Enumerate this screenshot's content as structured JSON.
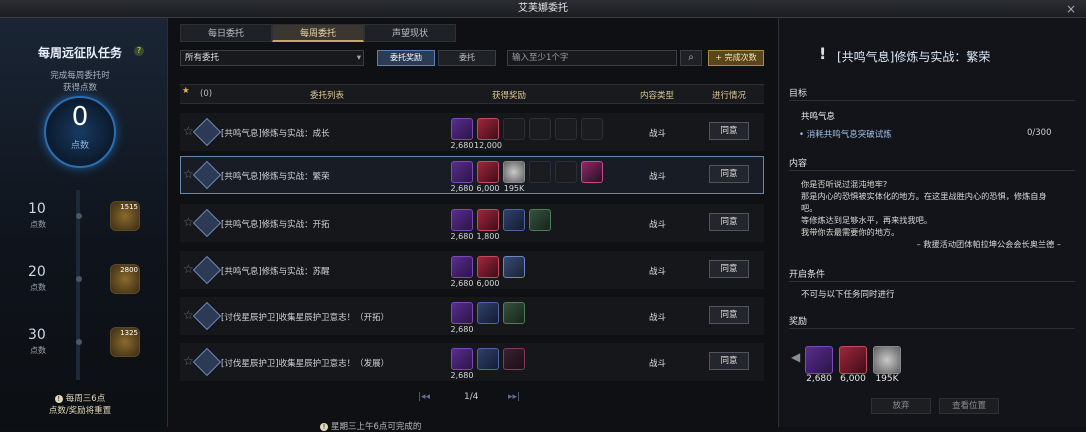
{
  "window": {
    "title": "艾芙娜委托",
    "close": "×"
  },
  "left": {
    "title": "每周远征队任务",
    "help": "?",
    "sub1": "完成每周委托时",
    "sub2": "获得点数",
    "points": "0",
    "points_unit": "点数",
    "steps": [
      {
        "value": "10",
        "unit": "点数",
        "coin": "1515"
      },
      {
        "value": "20",
        "unit": "点数",
        "coin": "2800"
      },
      {
        "value": "30",
        "unit": "点数",
        "coin": "1325"
      }
    ],
    "footer1": "每周三6点",
    "footer2": "点数/奖励将重置"
  },
  "main": {
    "tabs": [
      {
        "label": "每日委托"
      },
      {
        "label": "每周委托"
      },
      {
        "label": "声望现状"
      }
    ],
    "filter": "所有委托",
    "toggle_reward": "委托奖励",
    "toggle_commission": "委托",
    "search_placeholder": "输入至少1个字",
    "add_button": "+ 完成次数",
    "header": {
      "star_count": "(0)",
      "list": "委托列表",
      "reward": "获得奖励",
      "type": "内容类型",
      "progress": "进行情况"
    },
    "rows": [
      {
        "name": "[共鸣气息]修炼与实战：成长",
        "n1": "2,680",
        "n2": "12,000",
        "n3": "",
        "type": "战斗",
        "btn": "同意"
      },
      {
        "name": "[共鸣气息]修炼与实战：繁荣",
        "n1": "2,680",
        "n2": "6,000",
        "n3": "195K",
        "type": "战斗",
        "btn": "同意"
      },
      {
        "name": "[共鸣气息]修炼与实战：开拓",
        "n1": "2,680",
        "n2": "1,800",
        "n3": "",
        "type": "战斗",
        "btn": "同意"
      },
      {
        "name": "[共鸣气息]修炼与实战：苏醒",
        "n1": "2,680",
        "n2": "6,000",
        "n3": "",
        "type": "战斗",
        "btn": "同意"
      },
      {
        "name": "[讨伐星辰护卫]收集星辰护卫意志！（开拓）",
        "n1": "2,680",
        "n2": "",
        "n3": "",
        "type": "战斗",
        "btn": "同意"
      },
      {
        "name": "[讨伐星辰护卫]收集星辰护卫意志！（发展）",
        "n1": "2,680",
        "n2": "",
        "n3": "",
        "type": "战斗",
        "btn": "同意"
      }
    ],
    "page": "1/4",
    "notice": "星期三上午6点可完成的"
  },
  "right": {
    "title": "[共鸣气息]修炼与实战：繁荣",
    "target_label": "目标",
    "objective": "共鸣气息",
    "goal": "• 消耗共鸣气息突破试炼",
    "goal_value": "0/300",
    "content_label": "内容",
    "desc": [
      "你是否听说过混沌地牢?",
      "那是内心的恐惧被实体化的地方。在这里战胜内心的恐惧，修炼自身",
      "吧。",
      "等修炼达到足够水平，再来找我吧。",
      "我带你去最需要你的地方。",
      "– 救援活动团体帕拉坤公会会长奥兰德 –"
    ],
    "cond_label": "开启条件",
    "cond": "不可与以下任务同时进行",
    "reward_label": "奖励",
    "rewards": [
      {
        "num": "2,680"
      },
      {
        "num": "6,000"
      },
      {
        "num": "195K"
      }
    ],
    "btn_abandon": "放弃",
    "btn_locate": "查看位置"
  }
}
